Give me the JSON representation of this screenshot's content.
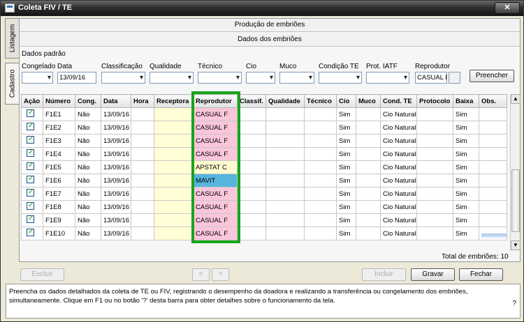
{
  "window": {
    "title": "Coleta FIV / TE",
    "close_label": "✕"
  },
  "side_tabs": [
    "Listagem",
    "Cadastro"
  ],
  "sections": {
    "production": "Produção de embriões",
    "embryo_data": "Dados dos embriões",
    "defaults": "Dados padrão"
  },
  "defaults_form": {
    "labels": {
      "congelado": "Congelado",
      "data": "Data",
      "classificacao": "Classificação",
      "qualidade": "Qualidade",
      "tecnico": "Técnico",
      "cio": "Cio",
      "muco": "Muco",
      "condicao_te": "Condição TE",
      "prot_iatf": "Prot. IATF",
      "reprodutor": "Reprodutor"
    },
    "data_value": "13/09/16",
    "reprodutor_value": "CASUAL F",
    "fill_button": "Preencher"
  },
  "table": {
    "columns": [
      "Ação",
      "Número",
      "Cong.",
      "Data",
      "Hora",
      "Receptora",
      "Reprodutor",
      "Classif.",
      "Qualidade",
      "Técnico",
      "Cio",
      "Muco",
      "Cond. TE",
      "Protocolo",
      "Baixa",
      "Obs."
    ],
    "rows": [
      {
        "numero": "F1E1",
        "cong": "Não",
        "data": "13/09/16",
        "reprodutor": "CASUAL F",
        "cio": "Sim",
        "cond_te": "Cio Natural",
        "baixa": "Sim"
      },
      {
        "numero": "F1E2",
        "cong": "Não",
        "data": "13/09/16",
        "reprodutor": "CASUAL F",
        "cio": "Sim",
        "cond_te": "Cio Natural",
        "baixa": "Sim"
      },
      {
        "numero": "F1E3",
        "cong": "Não",
        "data": "13/09/16",
        "reprodutor": "CASUAL F",
        "cio": "Sim",
        "cond_te": "Cio Natural",
        "baixa": "Sim"
      },
      {
        "numero": "F1E4",
        "cong": "Não",
        "data": "13/09/16",
        "reprodutor": "CASUAL F",
        "cio": "Sim",
        "cond_te": "Cio Natural",
        "baixa": "Sim"
      },
      {
        "numero": "F1E5",
        "cong": "Não",
        "data": "13/09/16",
        "reprodutor": "APSTAT C",
        "cio": "Sim",
        "cond_te": "Cio Natural",
        "baixa": "Sim"
      },
      {
        "numero": "F1E6",
        "cong": "Não",
        "data": "13/09/16",
        "reprodutor": "MAVIT",
        "cio": "Sim",
        "cond_te": "Cio Natural",
        "baixa": "Sim"
      },
      {
        "numero": "F1E7",
        "cong": "Não",
        "data": "13/09/16",
        "reprodutor": "CASUAL F",
        "cio": "Sim",
        "cond_te": "Cio Natural",
        "baixa": "Sim"
      },
      {
        "numero": "F1E8",
        "cong": "Não",
        "data": "13/09/16",
        "reprodutor": "CASUAL F",
        "cio": "Sim",
        "cond_te": "Cio Natural",
        "baixa": "Sim"
      },
      {
        "numero": "F1E9",
        "cong": "Não",
        "data": "13/09/16",
        "reprodutor": "CASUAL F",
        "cio": "Sim",
        "cond_te": "Cio Natural",
        "baixa": "Sim"
      },
      {
        "numero": "F1E10",
        "cong": "Não",
        "data": "13/09/16",
        "reprodutor": "CASUAL F",
        "cio": "Sim",
        "cond_te": "Cio Natural",
        "baixa": "Sim"
      }
    ],
    "total_label": "Total de embriões: 10"
  },
  "actions": {
    "excluir": "Excluir",
    "prev": "<",
    "next": ">",
    "incluir": "Incluir",
    "gravar": "Gravar",
    "fechar": "Fechar"
  },
  "status": {
    "message": "Preencha os dados detalhados da coleta de TE ou FIV, registrando o desempenho da doadora e realizando a transferência ou congelamento dos embriões, simultaneamente.  Clique em F1 ou no botão '?' desta barra para obter detalhes sobre o funcionamento da tela.",
    "help": "?"
  },
  "colors": {
    "highlight": "#19a31b",
    "reprodutor_casual": "#f9c6dc",
    "reprodutor_mavit": "#58b5dd",
    "receptora_bg": "#fffed6"
  }
}
